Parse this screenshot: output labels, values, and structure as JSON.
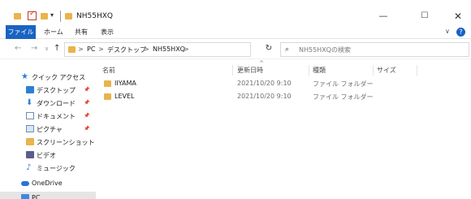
{
  "window": {
    "title": "NH55HXQ",
    "minimize_glyph": "—",
    "maximize_glyph": "☐",
    "close_glyph": "✕"
  },
  "quick_access_toolbar": {
    "dropdown_glyph": "▾"
  },
  "ribbon": {
    "tabs": [
      {
        "label": "ファイル"
      },
      {
        "label": "ホーム"
      },
      {
        "label": "共有"
      },
      {
        "label": "表示"
      }
    ],
    "expand_glyph": "∨",
    "help_glyph": "?"
  },
  "navigation": {
    "back_glyph": "←",
    "forward_glyph": "→",
    "recent_glyph": "∨",
    "up_glyph": "↑"
  },
  "address": {
    "crumbs": [
      "PC",
      "デスクトップ",
      "NH55HXQ"
    ],
    "separator": ">",
    "dropdown_glyph": "∨",
    "refresh_glyph": "↻"
  },
  "search": {
    "placeholder": "NH55HXQの検索",
    "icon": "search-icon"
  },
  "sidebar": {
    "quick_access_label": "クイック アクセス",
    "items": [
      {
        "label": "デスクトップ",
        "icon": "desktop-icon",
        "pinned": true
      },
      {
        "label": "ダウンロード",
        "icon": "download-icon",
        "pinned": true
      },
      {
        "label": "ドキュメント",
        "icon": "documents-icon",
        "pinned": true
      },
      {
        "label": "ピクチャ",
        "icon": "pictures-icon",
        "pinned": true
      },
      {
        "label": "スクリーンショット",
        "icon": "folder-icon",
        "pinned": false
      },
      {
        "label": "ビデオ",
        "icon": "videos-icon",
        "pinned": false
      },
      {
        "label": "ミュージック",
        "icon": "music-icon",
        "pinned": false
      }
    ],
    "onedrive_label": "OneDrive",
    "pc_label": "PC",
    "pin_glyph": "📌"
  },
  "columns": {
    "sort_glyph": "^",
    "name": "名前",
    "date": "更新日時",
    "type": "種類",
    "size": "サイズ"
  },
  "files": [
    {
      "name": "IIYAMA",
      "date": "2021/10/20 9:10",
      "type": "ファイル フォルダー"
    },
    {
      "name": "LEVEL",
      "date": "2021/10/20 9:10",
      "type": "ファイル フォルダー"
    }
  ],
  "colors": {
    "accent": "#1a63c2",
    "folder": "#e9b44c"
  }
}
